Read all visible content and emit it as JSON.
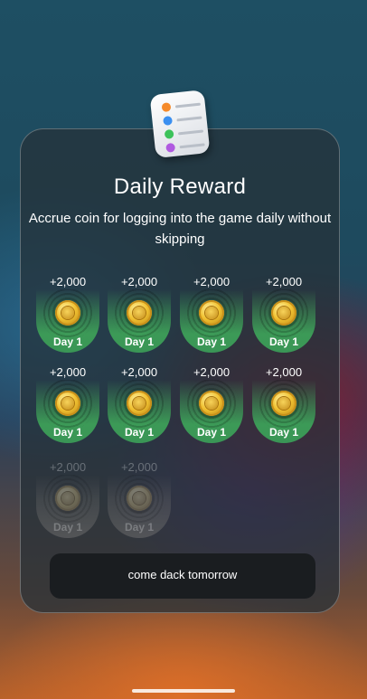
{
  "header": {
    "title": "Daily Reward",
    "subtitle": "Accrue coin for logging into the game daily without skipping"
  },
  "rewards": [
    {
      "amount": "+2,000",
      "label": "Day 1",
      "state": "claimed"
    },
    {
      "amount": "+2,000",
      "label": "Day 1",
      "state": "claimed"
    },
    {
      "amount": "+2,000",
      "label": "Day 1",
      "state": "claimed"
    },
    {
      "amount": "+2,000",
      "label": "Day 1",
      "state": "claimed"
    },
    {
      "amount": "+2,000",
      "label": "Day 1",
      "state": "claimed"
    },
    {
      "amount": "+2,000",
      "label": "Day 1",
      "state": "claimed"
    },
    {
      "amount": "+2,000",
      "label": "Day 1",
      "state": "claimed"
    },
    {
      "amount": "+2,000",
      "label": "Day 1",
      "state": "claimed"
    },
    {
      "amount": "+2,000",
      "label": "Day 1",
      "state": "locked"
    },
    {
      "amount": "+2,000",
      "label": "Day 1",
      "state": "locked"
    }
  ],
  "cta": {
    "label": "come dack tomorrow"
  },
  "icons": {
    "header": "notepad-icon",
    "reward": "coin-icon"
  },
  "colors": {
    "claimed": "#3c9a57",
    "locked": "#6f6f6f",
    "button": "#1a1d20"
  }
}
